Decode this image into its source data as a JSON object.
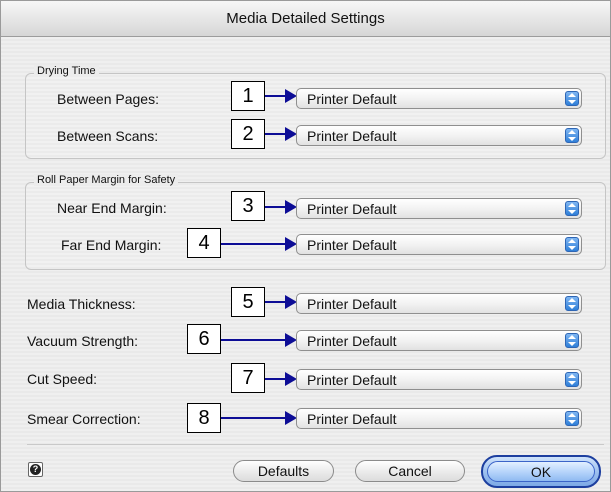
{
  "dialog": {
    "title": "Media Detailed Settings"
  },
  "groups": {
    "drying_time": {
      "label": "Drying Time"
    },
    "roll_margin": {
      "label": "Roll Paper Margin for Safety"
    }
  },
  "settings": [
    {
      "label": "Between Pages:",
      "value": "Printer Default",
      "callout": "1"
    },
    {
      "label": "Between Scans:",
      "value": "Printer Default",
      "callout": "2"
    },
    {
      "label": "Near End Margin:",
      "value": "Printer Default",
      "callout": "3"
    },
    {
      "label": "Far End Margin:",
      "value": "Printer Default",
      "callout": "4"
    },
    {
      "label": "Media Thickness:",
      "value": "Printer Default",
      "callout": "5"
    },
    {
      "label": "Vacuum Strength:",
      "value": "Printer Default",
      "callout": "6"
    },
    {
      "label": "Cut Speed:",
      "value": "Printer Default",
      "callout": "7"
    },
    {
      "label": "Smear Correction:",
      "value": "Printer Default",
      "callout": "8"
    }
  ],
  "buttons": {
    "defaults": "Defaults",
    "cancel": "Cancel",
    "ok": "OK"
  },
  "icons": {
    "help": "question-mark-icon",
    "popup": "up-down-stepper-icon"
  },
  "colors": {
    "arrow": "#0d0d96",
    "ok_button": "#9fc2ef",
    "stepper": "#2f7fd8"
  }
}
